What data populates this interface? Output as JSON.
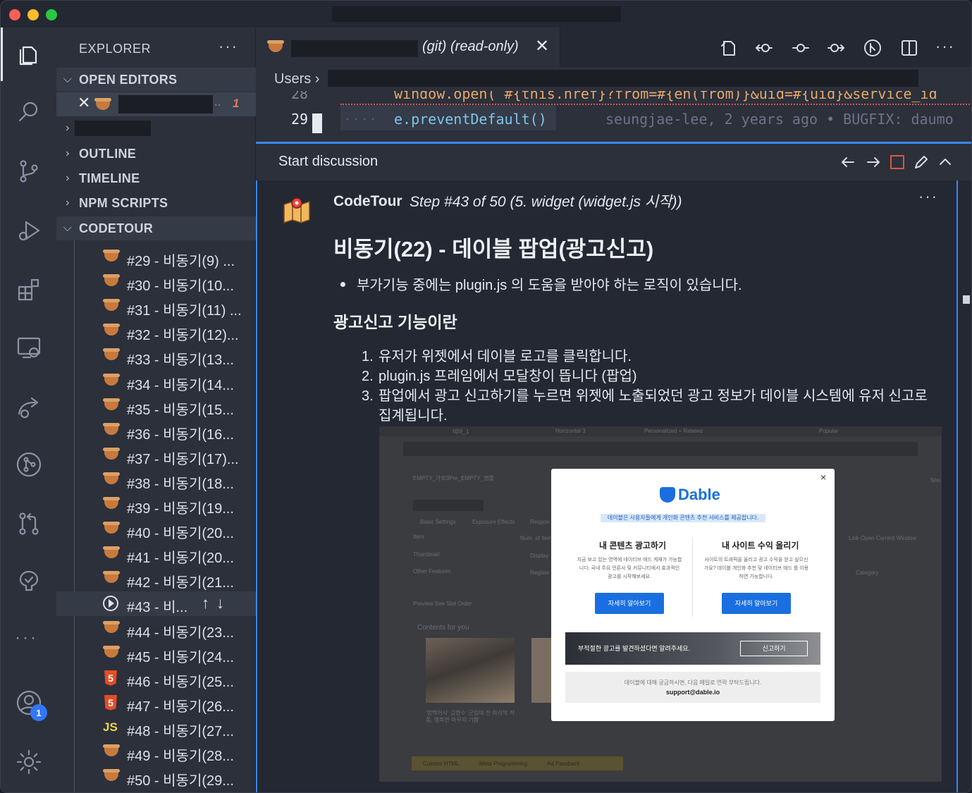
{
  "window": {
    "traffic_lights": [
      "close",
      "minimize",
      "zoom"
    ]
  },
  "activity_bar": {
    "items": [
      "explorer-icon",
      "search-icon",
      "source-control-icon",
      "run-debug-icon",
      "extensions-icon",
      "remote-explorer-icon",
      "live-share-icon",
      "git-graph-icon",
      "pull-requests-icon",
      "codetour-icon",
      "more-icon",
      "accounts-icon",
      "settings-icon"
    ],
    "accounts_badge": "1",
    "more_label": "···"
  },
  "sidebar": {
    "title": "EXPLORER",
    "more": "···",
    "open_editors": "OPEN EDITORS",
    "open_editor_dots": "..",
    "open_editor_problems": "1",
    "outline": "OUTLINE",
    "timeline": "TIMELINE",
    "npm_scripts": "NPM SCRIPTS",
    "codetour": "CODETOUR",
    "steps": [
      {
        "label": "#29 - 비동기(9) ...",
        "icon": "cup"
      },
      {
        "label": "#30 - 비동기(10...",
        "icon": "cup"
      },
      {
        "label": "#31 - 비동기(11) ...",
        "icon": "cup"
      },
      {
        "label": "#32 - 비동기(12)...",
        "icon": "cup"
      },
      {
        "label": "#33 - 비동기(13...",
        "icon": "cup"
      },
      {
        "label": "#34 - 비동기(14...",
        "icon": "cup"
      },
      {
        "label": "#35 - 비동기(15...",
        "icon": "cup"
      },
      {
        "label": "#36 - 비동기(16...",
        "icon": "cup"
      },
      {
        "label": "#37 - 비동기(17)...",
        "icon": "cup"
      },
      {
        "label": "#38 - 비동기(18...",
        "icon": "cup"
      },
      {
        "label": "#39 - 비동기(19...",
        "icon": "cup"
      },
      {
        "label": "#40 - 비동기(20...",
        "icon": "cup"
      },
      {
        "label": "#41 - 비동기(20...",
        "icon": "cup"
      },
      {
        "label": "#42 - 비동기(21...",
        "icon": "cup"
      },
      {
        "label": "#43 - 비...",
        "icon": "play"
      },
      {
        "label": "#44 - 비동기(23...",
        "icon": "cup"
      },
      {
        "label": "#45 - 비동기(24...",
        "icon": "cup"
      },
      {
        "label": "#46 - 비동기(25...",
        "icon": "html5"
      },
      {
        "label": "#47 - 비동기(26...",
        "icon": "html5"
      },
      {
        "label": "#48 - 비동기(27...",
        "icon": "js"
      },
      {
        "label": "#49 - 비동기(28...",
        "icon": "cup"
      },
      {
        "label": "#50 - 비동기(29...",
        "icon": "cup"
      }
    ],
    "current_arrows": "↑↓"
  },
  "tab": {
    "suffix": "(git) (read-only)",
    "close": "✕"
  },
  "breadcrumbs": {
    "root": "Users"
  },
  "editor": {
    "line_28": "28",
    "line_28_code": "window.open(`#{this.href}?from=#{en(from)}&uid=#{uid}&service_id",
    "line_29": "29",
    "line_29_code": "e.preventDefault()",
    "blame": "seungjae-lee, 2 years ago • BUGFIX: daumo"
  },
  "peek": {
    "title": "Start discussion",
    "author": "CodeTour",
    "step_info": "Step #43 of 50 (5. widget (widget.js 시작))",
    "more": "···",
    "heading": "비동기(22) - 데이블 팝업(광고신고)",
    "bullet": "부가기능 중에는 plugin.js 의 도움을 받아야 하는 로직이 있습니다.",
    "subheading": "광고신고 기능이란",
    "list": [
      {
        "num": "1.",
        "text": "유저가 위젯에서 데이블 로고를 클릭합니다."
      },
      {
        "num": "2.",
        "text": "plugin.js 프레임에서 모달창이 뜹니다 (팝업)"
      },
      {
        "num": "3.",
        "text": "팝업에서 광고 신고하기를 누르면 위젯에 노출되었던 광고 정보가 데이블 시스템에 유저 신고로 집계됩니다."
      }
    ]
  },
  "screenshot_image": {
    "bg_tabs": [
      "테마_1",
      "Horizontal 3",
      "Personalized + Related",
      "Popular"
    ],
    "bg_title": "EMPTY_가로3Pre_EMPTY_썸플",
    "bg_subtabs": [
      "Basic Settings",
      "Exposure Effects",
      "Respon"
    ],
    "bg_item": "Item",
    "bg_num_items": "Num. of Item",
    "bg_thumbnail": "Thumbnail",
    "bg_display": "Display",
    "bg_other": "Other Features",
    "bg_register": "Registe",
    "bg_preview": "Preview  See Slot Order",
    "bg_contents": "Contents for you",
    "bg_link_open": "Link Open  Current Window",
    "bg_category": "Category",
    "bg_show": "Sho",
    "bg_caption": "'함쩍어사' 김명수 '군입대 전 마지막 작품, 행복한 마무리 기쁨'",
    "bg_bottom_tabs": [
      "Custom HTML",
      "Meta Programming",
      "Ad Passback"
    ],
    "modal_close": "×",
    "brand": "Dable",
    "tagline": "데이블은 사용자들에게 개인화 콘텐츠 추천 서비스를 제공합니다.",
    "left_title": "내 콘텐츠 광고하기",
    "left_desc": "지금 보고 있는 영역에 네이티브 애드 게재가 가능합니다. 국내 주요 언론사 및 커뮤니티에서 효과적인 광고를 시작해보세요.",
    "right_title": "내 사이트 수익 올리기",
    "right_desc": "사이트의 트래픽을 올리고 광고 수익을 얻고 싶으신가요? 데이블 개인화 추천 및 네이티브 애드 를 이용하면 가능합니다.",
    "button": "자세히 알아보기",
    "report_text": "부적절한 광고를 발견하셨다면 알려주세요.",
    "report_button": "신고하기",
    "contact_text": "데이블에 대해 궁금하시면, 다음 메일로 연락 부탁드립니다.",
    "contact_email": "support@dable.io"
  },
  "colors": {
    "accent": "#3b86f7",
    "problem": "#e07a5f",
    "dable_blue": "#1a6fe0"
  }
}
